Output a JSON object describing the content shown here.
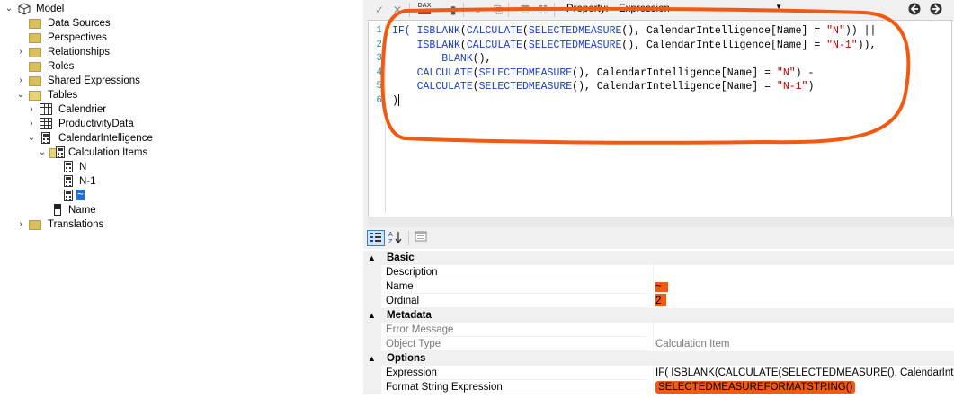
{
  "tree": {
    "model": "Model",
    "data_sources": "Data Sources",
    "perspectives": "Perspectives",
    "relationships": "Relationships",
    "roles": "Roles",
    "shared_expressions": "Shared Expressions",
    "tables": "Tables",
    "calendrier": "Calendrier",
    "productivity_data": "ProductivityData",
    "calendar_intelligence": "CalendarIntelligence",
    "calculation_items": "Calculation Items",
    "item_n": "N",
    "item_n1": "N-1",
    "item_tilde": "~",
    "name_col": "Name",
    "translations": "Translations"
  },
  "toolbar": {
    "dax_label": "DAX",
    "property_label": "Property:",
    "property_value": "Expression"
  },
  "editor": {
    "line_numbers": [
      "1",
      "2",
      "3",
      "4",
      "5",
      "6"
    ],
    "line1_a": "IF( ",
    "line1_b": "ISBLANK",
    "line1_c": "(",
    "line1_d": "CALCULATE",
    "line1_e": "(",
    "line1_f": "SELECTEDMEASURE",
    "line1_g": "(), CalendarIntelligence[Name] = ",
    "line1_h": "\"N\"",
    "line1_i": ")) ||",
    "line2_a": "    ",
    "line2_b": "ISBLANK",
    "line2_c": "(",
    "line2_d": "CALCULATE",
    "line2_e": "(",
    "line2_f": "SELECTEDMEASURE",
    "line2_g": "(), CalendarIntelligence[Name] = ",
    "line2_h": "\"N-1\"",
    "line2_i": ")),",
    "line3_a": "        ",
    "line3_b": "BLANK",
    "line3_c": "(),",
    "line4_a": "    ",
    "line4_b": "CALCULATE",
    "line4_c": "(",
    "line4_d": "SELECTEDMEASURE",
    "line4_e": "(), CalendarIntelligence[Name] = ",
    "line4_f": "\"N\"",
    "line4_g": ") -",
    "line5_a": "    ",
    "line5_b": "CALCULATE",
    "line5_c": "(",
    "line5_d": "SELECTEDMEASURE",
    "line5_e": "(), CalendarIntelligence[Name] = ",
    "line5_f": "\"N-1\"",
    "line5_g": ")",
    "line6": ")"
  },
  "property_grid": {
    "categories": {
      "basic": "Basic",
      "metadata": "Metadata",
      "options": "Options"
    },
    "rows": {
      "description": {
        "name": "Description",
        "value": ""
      },
      "name": {
        "name": "Name",
        "value": "~"
      },
      "ordinal": {
        "name": "Ordinal",
        "value": "2"
      },
      "error_message": {
        "name": "Error Message",
        "value": ""
      },
      "object_type": {
        "name": "Object Type",
        "value": "Calculation Item"
      },
      "expression": {
        "name": "Expression",
        "value": "IF( ISBLANK(CALCULATE(SELECTEDMEASURE(), CalendarIntelligen"
      },
      "format_string": {
        "name": "Format String Expression",
        "value": "SELECTEDMEASUREFORMATSTRING()"
      }
    }
  },
  "colors": {
    "annotation": "#f05a14",
    "keyword": "#1c3fb6",
    "string": "#c00000",
    "selection": "#1e73d2"
  }
}
